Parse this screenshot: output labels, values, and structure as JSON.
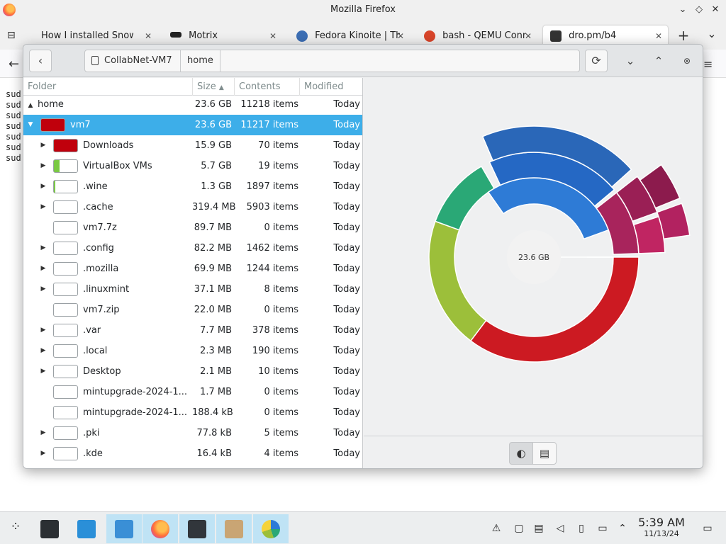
{
  "firefox": {
    "title": "Mozilla Firefox",
    "tabs": [
      {
        "label": "How I installed Snow L",
        "close": "✕"
      },
      {
        "label": "Motrix",
        "close": "✕"
      },
      {
        "label": "Fedora Kinoite | Th",
        "close": "✕"
      },
      {
        "label": "bash - QEMU Conn",
        "close": "✕"
      },
      {
        "label": "dro.pm/b4",
        "close": "✕"
      }
    ],
    "new_tab": "+",
    "list_tabs": "⌄",
    "page_lines": [
      "sud",
      "sud",
      "sud",
      "sud",
      "sud",
      "sud",
      "sud"
    ]
  },
  "filelight": {
    "breadcrumbs": [
      "CollabNet-VM7",
      "home"
    ],
    "columns": {
      "folder": "Folder",
      "size": "Size",
      "contents": "Contents",
      "modified": "Modified"
    },
    "rows": [
      {
        "name": "home",
        "size": "23.6 GB",
        "contents": "11218 items",
        "modified": "Today"
      },
      {
        "name": "vm7",
        "size": "23.6 GB",
        "contents": "11217 items",
        "modified": "Today"
      },
      {
        "name": "Downloads",
        "size": "15.9 GB",
        "contents": "70 items",
        "modified": "Today"
      },
      {
        "name": "VirtualBox VMs",
        "size": "5.7 GB",
        "contents": "19 items",
        "modified": "Today"
      },
      {
        "name": ".wine",
        "size": "1.3 GB",
        "contents": "1897 items",
        "modified": "Today"
      },
      {
        "name": ".cache",
        "size": "319.4 MB",
        "contents": "5903 items",
        "modified": "Today"
      },
      {
        "name": "vm7.7z",
        "size": "89.7 MB",
        "contents": "0 items",
        "modified": "Today"
      },
      {
        "name": ".config",
        "size": "82.2 MB",
        "contents": "1462 items",
        "modified": "Today"
      },
      {
        "name": ".mozilla",
        "size": "69.9 MB",
        "contents": "1244 items",
        "modified": "Today"
      },
      {
        "name": ".linuxmint",
        "size": "37.1 MB",
        "contents": "8 items",
        "modified": "Today"
      },
      {
        "name": "vm7.zip",
        "size": "22.0 MB",
        "contents": "0 items",
        "modified": "Today"
      },
      {
        "name": ".var",
        "size": "7.7 MB",
        "contents": "378 items",
        "modified": "Today"
      },
      {
        "name": ".local",
        "size": "2.3 MB",
        "contents": "190 items",
        "modified": "Today"
      },
      {
        "name": "Desktop",
        "size": "2.1 MB",
        "contents": "10 items",
        "modified": "Today"
      },
      {
        "name": "mintupgrade-2024-1...",
        "size": "1.7 MB",
        "contents": "0 items",
        "modified": "Today"
      },
      {
        "name": "mintupgrade-2024-1...",
        "size": "188.4 kB",
        "contents": "0 items",
        "modified": "Today"
      },
      {
        "name": ".pki",
        "size": "77.8 kB",
        "contents": "5 items",
        "modified": "Today"
      },
      {
        "name": ".kde",
        "size": "16.4 kB",
        "contents": "4 items",
        "modified": "Today"
      }
    ],
    "center_label": "23.6 GB"
  },
  "taskbar": {
    "time": "5:39 AM",
    "date": "11/13/24"
  },
  "colors": {
    "selection": "#3daee9",
    "red": "#e31b23",
    "blue": "#2e7bd6",
    "green": "#2aa876",
    "lime": "#9cbf3a",
    "magenta": "#a8245c"
  }
}
